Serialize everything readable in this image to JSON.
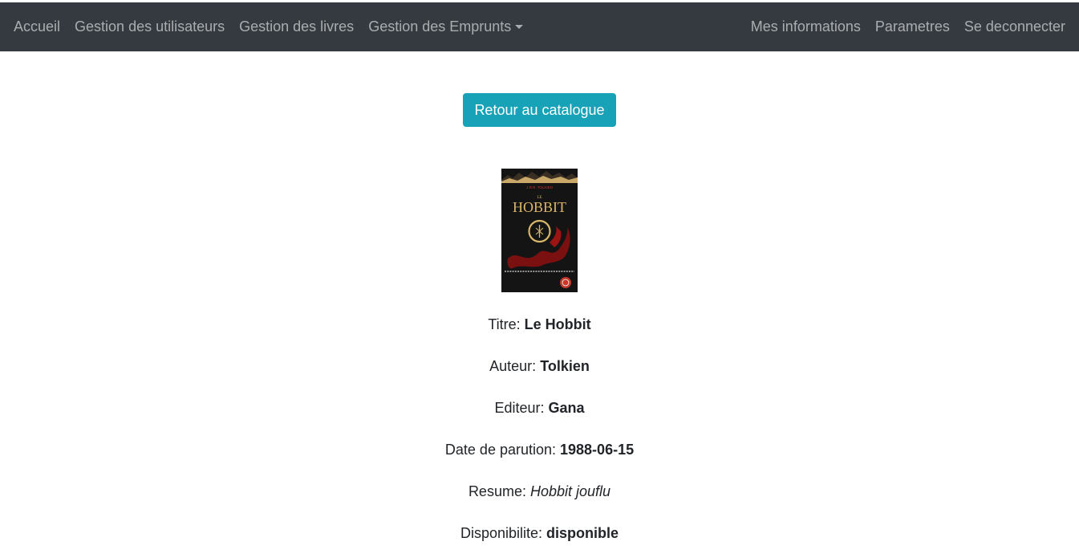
{
  "navbar": {
    "left_items": [
      {
        "label": "Accueil"
      },
      {
        "label": "Gestion des utilisateurs"
      },
      {
        "label": "Gestion des livres"
      },
      {
        "label": "Gestion des Emprunts"
      }
    ],
    "right_items": [
      {
        "label": "Mes informations"
      },
      {
        "label": "Parametres"
      },
      {
        "label": "Se deconnecter"
      }
    ],
    "background": "#343a40"
  },
  "main": {
    "back_button_label": "Retour au catalogue",
    "back_button_color": "#17a2b8",
    "cover": {
      "author_line": "J.R.R. TOLKIEN",
      "title_small": "LE",
      "title_big": "HOBBIT"
    },
    "fields": {
      "titre": {
        "label": "Titre:",
        "value": "Le Hobbit"
      },
      "auteur": {
        "label": "Auteur:",
        "value": "Tolkien"
      },
      "editeur": {
        "label": "Editeur:",
        "value": "Gana"
      },
      "date": {
        "label": "Date de parution:",
        "value": "1988-06-15"
      },
      "resume": {
        "label": "Resume:",
        "value": "Hobbit jouflu"
      },
      "dispo": {
        "label": "Disponibilite:",
        "value": "disponible"
      }
    }
  }
}
